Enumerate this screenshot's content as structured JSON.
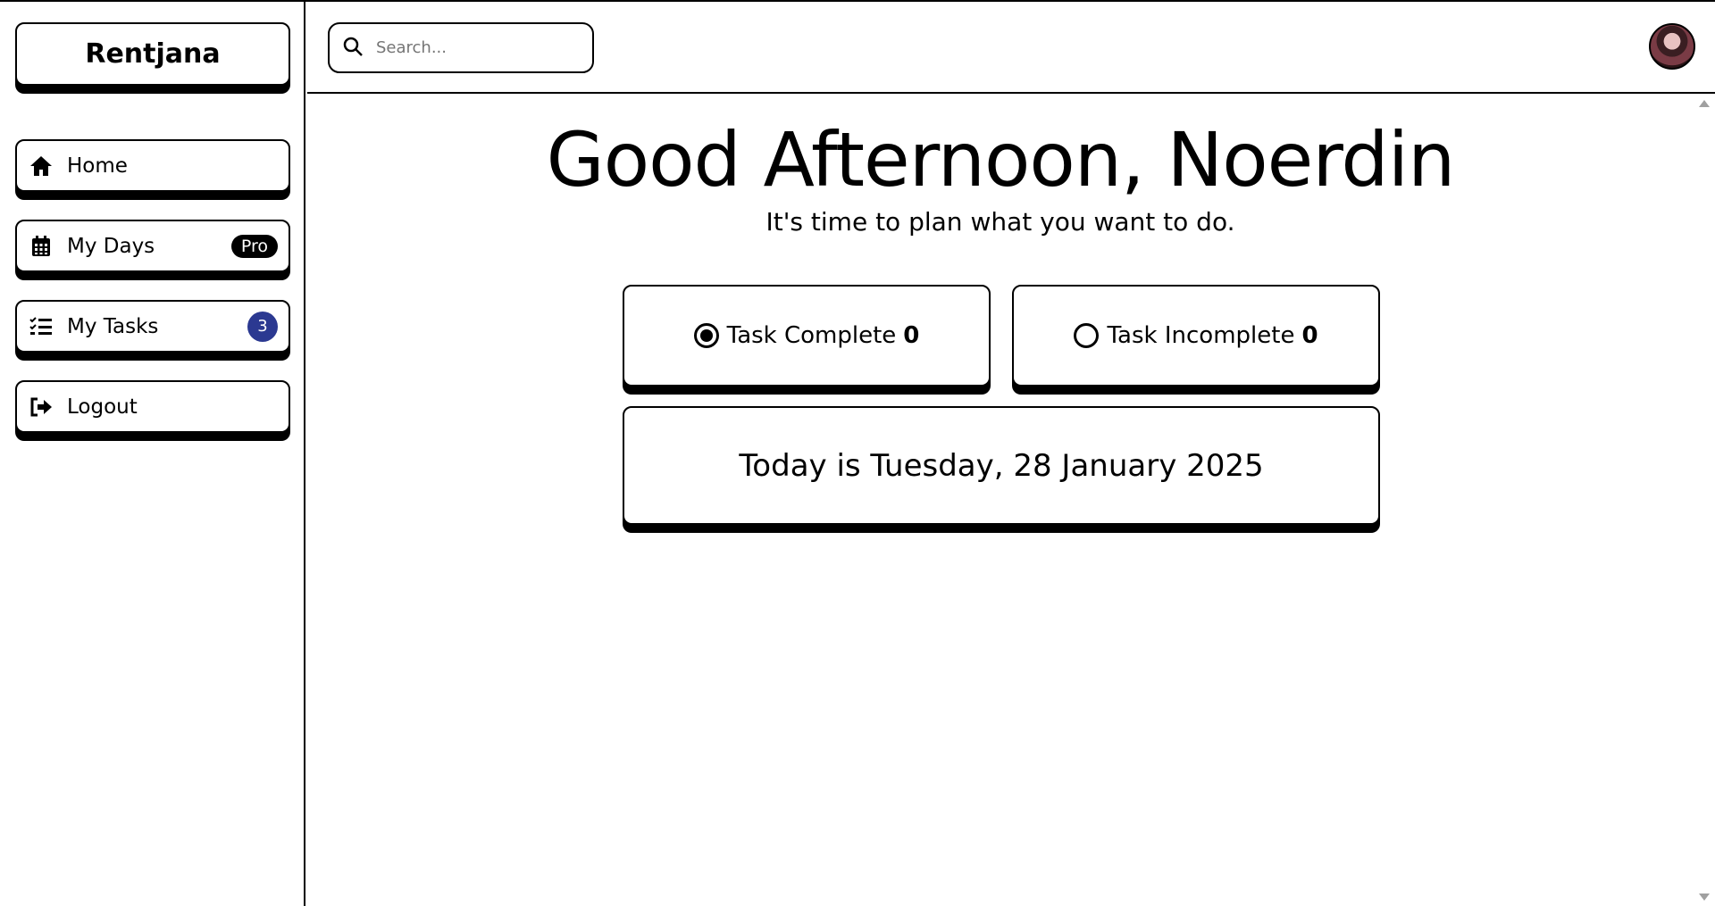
{
  "app": {
    "brand": "Rentjana"
  },
  "sidebar": {
    "items": [
      {
        "label": "Home",
        "icon": "home-icon"
      },
      {
        "label": "My Days",
        "icon": "calendar-icon",
        "badge": "Pro"
      },
      {
        "label": "My Tasks",
        "icon": "task-list-icon",
        "count": "3"
      },
      {
        "label": "Logout",
        "icon": "logout-icon"
      }
    ]
  },
  "search": {
    "placeholder": "Search..."
  },
  "main": {
    "greeting": "Good Afternoon, Noerdin",
    "subtitle": "It's time to plan what you want to do.",
    "task_complete": {
      "label": "Task Complete",
      "value": "0"
    },
    "task_incomplete": {
      "label": "Task Incomplete",
      "value": "0"
    },
    "date_text": "Today is Tuesday, 28 January 2025"
  },
  "colors": {
    "accent": "#2b3991",
    "border": "#000000",
    "background": "#ffffff"
  }
}
